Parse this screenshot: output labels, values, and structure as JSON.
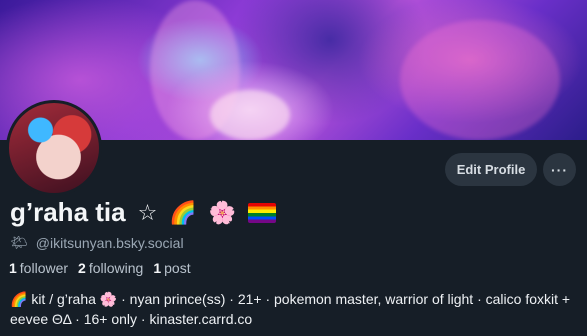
{
  "profile": {
    "display_name": "g’raha tia",
    "name_emojis": [
      "☆",
      "🌈",
      "🌸"
    ],
    "handle_emoji": "🌤",
    "handle": "@ikitsunyan.bsky.social",
    "stats": {
      "followers_count": "1",
      "followers_label": "follower",
      "following_count": "2",
      "following_label": "following",
      "posts_count": "1",
      "posts_label": "post"
    },
    "bio": "🌈 kit / g’raha 🌸 · nyan prince(ss) · 21+ · pokemon master, warrior of light · calico foxkit + eevee ΘΔ · 16+ only · kinaster.carrd.co"
  },
  "actions": {
    "edit_profile_label": "Edit Profile",
    "more_label": "···"
  },
  "colors": {
    "background": "#161e27",
    "button_bg": "#2b3540",
    "muted_text": "#9aa7b4"
  },
  "icons": {
    "banner": "anime-art-banner",
    "avatar": "avatar-image",
    "pride_flag": "rainbow-flag-icon"
  }
}
